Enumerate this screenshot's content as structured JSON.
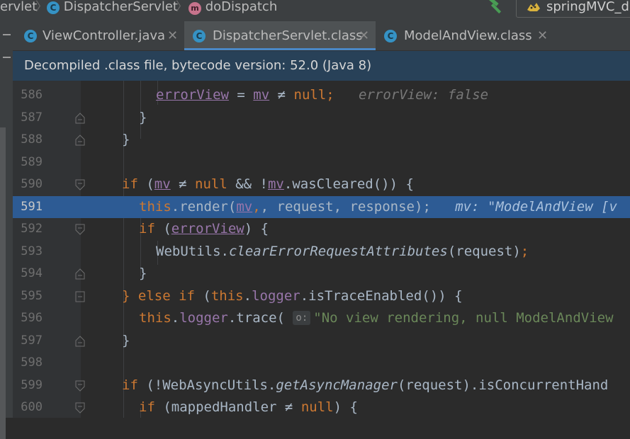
{
  "breadcrumb": {
    "items": [
      {
        "label": "ervlet"
      },
      {
        "icon": "class-icon",
        "label": "DispatcherServlet"
      },
      {
        "icon": "method-icon",
        "label": "doDispatch"
      }
    ]
  },
  "toolbar": {
    "run_config_label": "springMVC_d"
  },
  "tabs": [
    {
      "label": "ViewController.java",
      "active": false
    },
    {
      "label": "DispatcherServlet.class",
      "active": true
    },
    {
      "label": "ModelAndView.class",
      "active": false
    }
  ],
  "banner": {
    "text": "Decompiled .class file, bytecode version: 52.0 (Java 8)"
  },
  "editor": {
    "highlight_color": "#2d5b94",
    "lines": [
      {
        "num": "586"
      },
      {
        "num": "587"
      },
      {
        "num": "588"
      },
      {
        "num": "589"
      },
      {
        "num": "590"
      },
      {
        "num": "591"
      },
      {
        "num": "592"
      },
      {
        "num": "593"
      },
      {
        "num": "594"
      },
      {
        "num": "595"
      },
      {
        "num": "596"
      },
      {
        "num": "597"
      },
      {
        "num": "598"
      },
      {
        "num": "599"
      },
      {
        "num": "600"
      }
    ],
    "tokens": {
      "errorView": "errorView",
      "eq": " = ",
      "mv": "mv",
      "neq": " ≠ ",
      "null": "null",
      "semi": ";",
      "hint_586": "errorView: false",
      "close_brace": "}",
      "if_kw": "if",
      "open_paren": " (",
      "and_not": " && !",
      "wasCleared": "wasCleared",
      "call_open_brace": "()) {",
      "this_kw": "this",
      "render": "render",
      "comma_request": ", request",
      "comma_response": ", response",
      "close_semi": ");",
      "hint_591": "mv: \"ModelAndView [v",
      "errorView_cond_close": ") {",
      "WebUtils": "WebUtils.",
      "clearErrorRequestAttributes": "clearErrorRequestAttributes",
      "request_arg": "(request)",
      "else_kw": "} else if",
      "logger": "logger",
      "isTraceEnabled": "isTraceEnabled",
      "trace": "trace",
      "inlay_o": "o:",
      "trace_str": "\"No view rendering, null ModelAndView",
      "webasync_open": " (!WebAsyncUtils.",
      "getAsyncManager": "getAsyncManager",
      "isConcurrentHandling": ".isConcurrentHand",
      "mappedHandler": " (mappedHandler",
      "brace_open": ") {"
    }
  }
}
